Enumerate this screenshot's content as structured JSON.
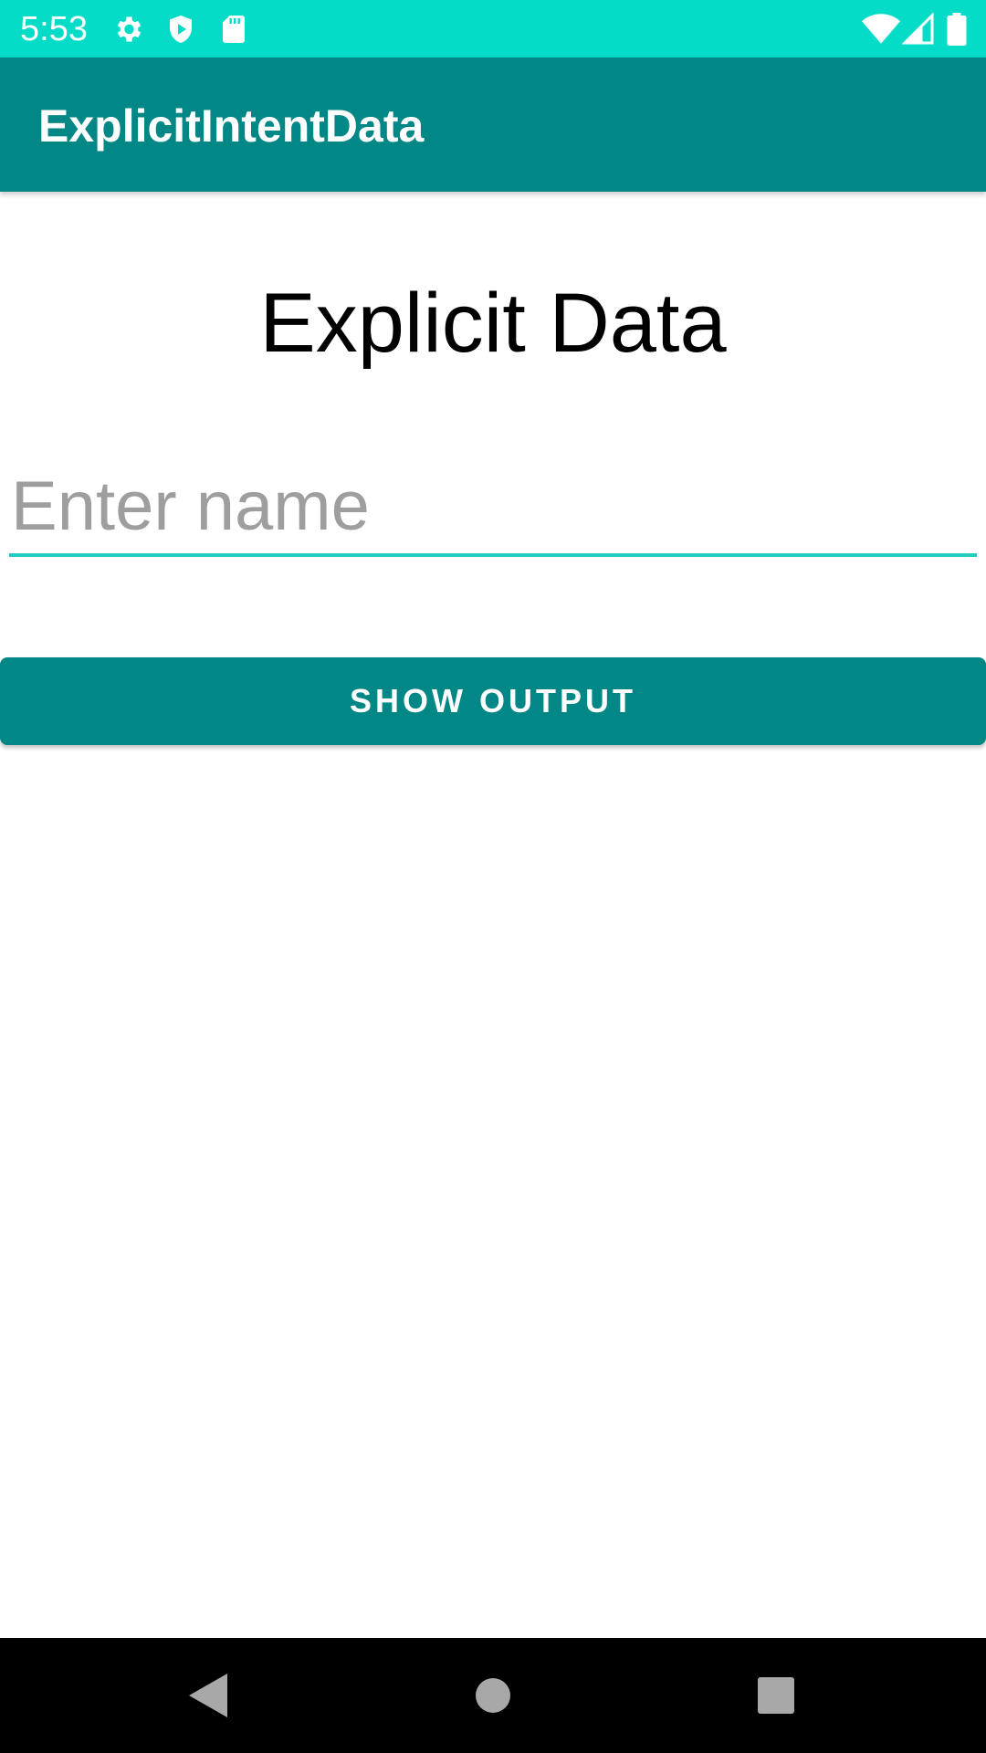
{
  "status_bar": {
    "time": "5:53",
    "left_icons": [
      "settings-icon",
      "shield-play-icon",
      "sd-card-icon"
    ],
    "right_icons": [
      "wifi-icon",
      "cell-signal-icon",
      "battery-icon"
    ]
  },
  "app_bar": {
    "title": "ExplicitIntentData"
  },
  "main": {
    "heading": "Explicit Data",
    "name_input": {
      "value": "",
      "placeholder": "Enter name"
    },
    "show_output_label": "SHOW OUTPUT"
  },
  "nav_bar": {
    "buttons": [
      "back-icon",
      "home-icon",
      "recents-icon"
    ]
  },
  "colors": {
    "status_bar": "#05dcc8",
    "primary": "#018786",
    "input_underline": "#1fcdbf",
    "nav_bar": "#000000"
  }
}
